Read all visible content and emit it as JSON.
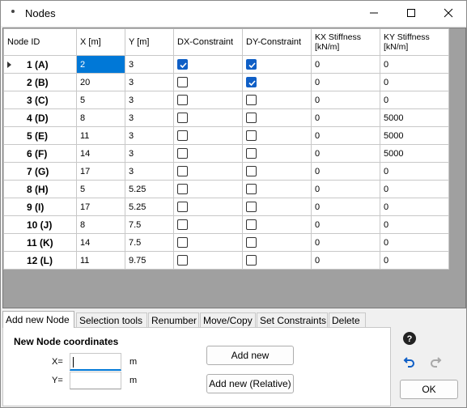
{
  "window": {
    "title": "Nodes"
  },
  "grid": {
    "columns": [
      "Node ID",
      "X [m]",
      "Y [m]",
      "DX-Constraint",
      "DY-Constraint",
      "KX Stiffness [kN/m]",
      "KY Stiffness [kN/m]"
    ],
    "rows": [
      {
        "id": "1 (A)",
        "x": "2",
        "y": "3",
        "dx": true,
        "dy": true,
        "kx": "0",
        "ky": "0"
      },
      {
        "id": "2 (B)",
        "x": "20",
        "y": "3",
        "dx": false,
        "dy": true,
        "kx": "0",
        "ky": "0"
      },
      {
        "id": "3 (C)",
        "x": "5",
        "y": "3",
        "dx": false,
        "dy": false,
        "kx": "0",
        "ky": "0"
      },
      {
        "id": "4 (D)",
        "x": "8",
        "y": "3",
        "dx": false,
        "dy": false,
        "kx": "0",
        "ky": "5000"
      },
      {
        "id": "5 (E)",
        "x": "11",
        "y": "3",
        "dx": false,
        "dy": false,
        "kx": "0",
        "ky": "5000"
      },
      {
        "id": "6 (F)",
        "x": "14",
        "y": "3",
        "dx": false,
        "dy": false,
        "kx": "0",
        "ky": "5000"
      },
      {
        "id": "7 (G)",
        "x": "17",
        "y": "3",
        "dx": false,
        "dy": false,
        "kx": "0",
        "ky": "0"
      },
      {
        "id": "8 (H)",
        "x": "5",
        "y": "5.25",
        "dx": false,
        "dy": false,
        "kx": "0",
        "ky": "0"
      },
      {
        "id": "9 (I)",
        "x": "17",
        "y": "5.25",
        "dx": false,
        "dy": false,
        "kx": "0",
        "ky": "0"
      },
      {
        "id": "10 (J)",
        "x": "8",
        "y": "7.5",
        "dx": false,
        "dy": false,
        "kx": "0",
        "ky": "0"
      },
      {
        "id": "11 (K)",
        "x": "14",
        "y": "7.5",
        "dx": false,
        "dy": false,
        "kx": "0",
        "ky": "0"
      },
      {
        "id": "12 (L)",
        "x": "11",
        "y": "9.75",
        "dx": false,
        "dy": false,
        "kx": "0",
        "ky": "0"
      }
    ]
  },
  "tabs": [
    "Add new Node",
    "Selection tools",
    "Renumber",
    "Move/Copy",
    "Set Constraints",
    "Delete"
  ],
  "panel": {
    "title": "New Node coordinates",
    "x_label": "X=",
    "y_label": "Y=",
    "unit": "m",
    "x_value": "",
    "y_value": "",
    "add_new": "Add new",
    "add_new_relative": "Add new (Relative)"
  },
  "ok": "OK",
  "colors": {
    "accent": "#0078d7",
    "check": "#0f5fc6",
    "grid_bg": "#a0a0a0"
  }
}
